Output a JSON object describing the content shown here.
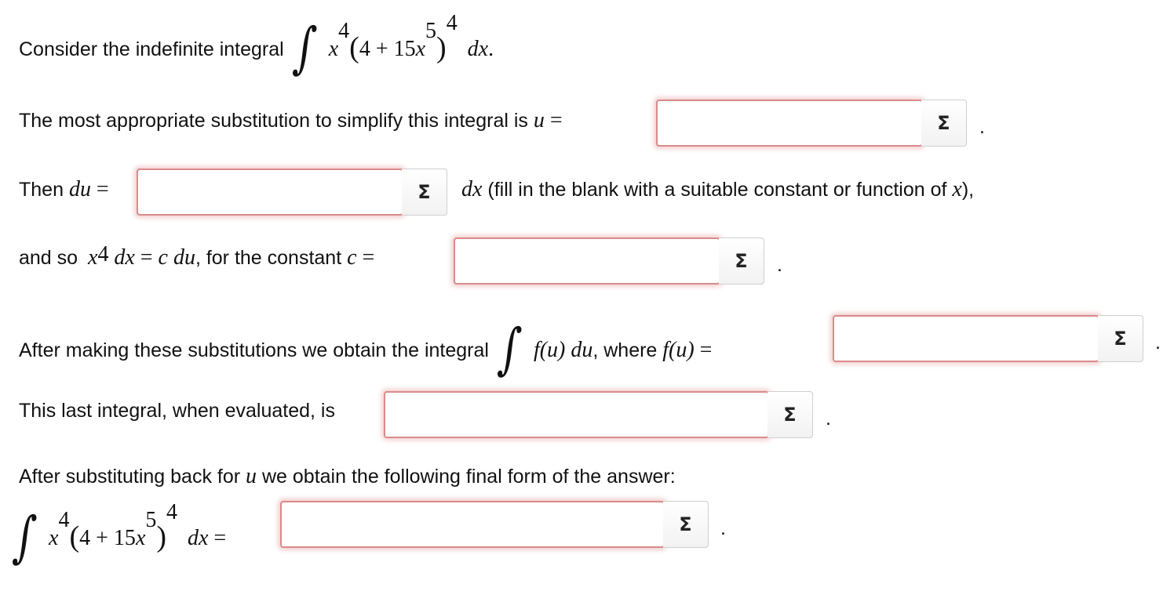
{
  "q1": {
    "text": "Consider the indefinite integral"
  },
  "q2": {
    "text": "The most appropriate substitution to simplify this integral is"
  },
  "q3": {
    "prefix": "Then",
    "text": "(fill in the blank with a suitable constant or function of"
  },
  "q4": {
    "prefix": "and so",
    "text": ", for the constant"
  },
  "q5": {
    "text": "After making these substitutions we obtain the integral",
    "where": ", where"
  },
  "q6": {
    "text": "This last integral, when evaluated, is"
  },
  "q7": {
    "text": "After substituting back for",
    "text2": "we obtain the following final form of the answer:"
  },
  "math": {
    "x": "x",
    "four": "4",
    "plus_coeff": "4 + 15",
    "five": "5",
    "dx": "dx",
    "u": "u",
    "du": "du",
    "c": "c",
    "f": "f",
    "eq": "=",
    "period": ".",
    "open_paren": "(",
    "close_paren": ")",
    "comma_close": "),",
    "f_u": "f(u)"
  },
  "sigma_label": "Σ",
  "fields": [
    {
      "name": "u-input",
      "value": ""
    },
    {
      "name": "du-input",
      "value": ""
    },
    {
      "name": "c-input",
      "value": ""
    },
    {
      "name": "fu-input",
      "value": ""
    },
    {
      "name": "evaluated-input",
      "value": ""
    },
    {
      "name": "final-answer-input",
      "value": ""
    }
  ],
  "colors": {
    "field_border": "#d98b8b",
    "field_glow": "#e08080"
  }
}
